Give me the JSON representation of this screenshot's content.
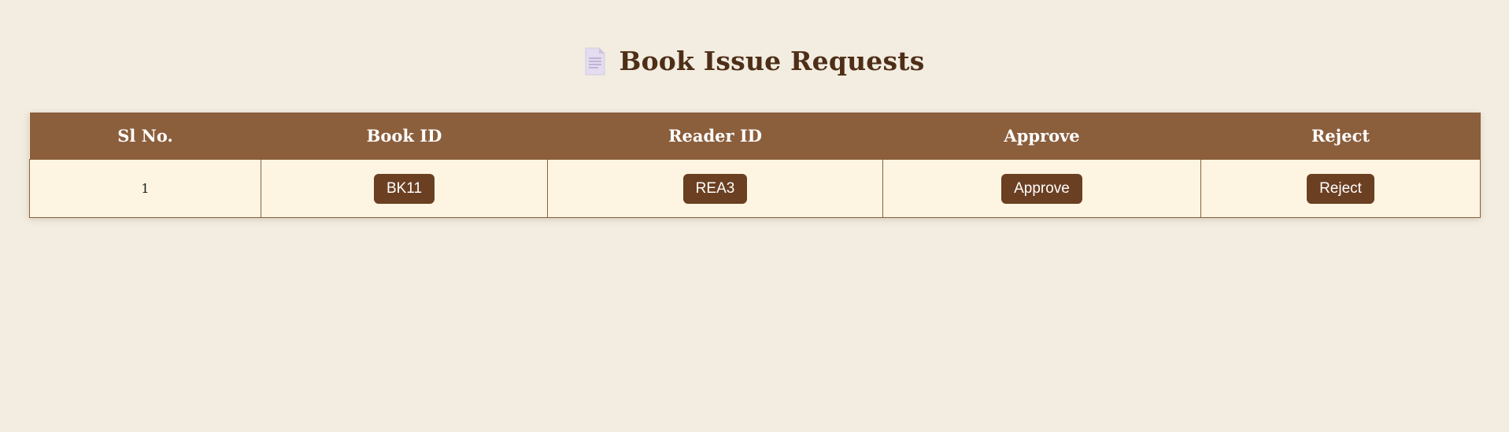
{
  "page": {
    "title": "Book Issue Requests",
    "title_icon": "document-icon"
  },
  "table": {
    "headers": [
      "Sl No.",
      "Book ID",
      "Reader ID",
      "Approve",
      "Reject"
    ],
    "rows": [
      {
        "sl_no": "1",
        "book_id": "BK11",
        "reader_id": "REA3",
        "approve_label": "Approve",
        "reject_label": "Reject"
      }
    ]
  },
  "colors": {
    "background": "#f2ede0",
    "header_bg": "#8b5e3c",
    "button_bg": "#6b3f22",
    "row_bg": "#fdf5e2",
    "title_text": "#4e2e17"
  }
}
